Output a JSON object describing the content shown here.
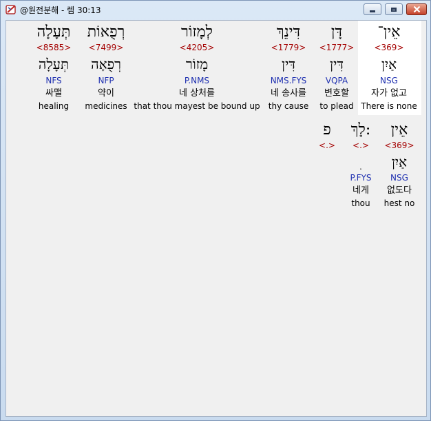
{
  "window": {
    "title": "@원전분해 - 렘 30:13"
  },
  "colors": {
    "strong": "#a40000",
    "morph": "#1e2fb0",
    "highlight": "#ffffff"
  },
  "row1": [
    {
      "heb": "אֵין־",
      "strong": "<369>",
      "heb2": "אַיִן",
      "morph": "NSG",
      "kor": "자가 없고",
      "eng": "There is none",
      "highlight": true
    },
    {
      "heb": "דָּן",
      "strong": "<1777>",
      "heb2": "דִּין",
      "morph": "VQPA",
      "kor": "변호할",
      "eng": "to plead"
    },
    {
      "heb": "דִּינֵךְ",
      "strong": "<1779>",
      "heb2": "דִּין",
      "morph": "NMS.FYS",
      "kor": "네 송사를",
      "eng": "thy cause"
    },
    {
      "heb": "לְמָזוֹר",
      "strong": "<4205>",
      "heb2": "מָזוֹר",
      "morph": "P.NMS",
      "kor": "네 상처를",
      "eng": "that thou mayest be bound up"
    },
    {
      "heb": "רְפֻאוֹת",
      "strong": "<7499>",
      "heb2": "רְפֻאָה",
      "morph": "NFP",
      "kor": "약이",
      "eng": "medicines"
    },
    {
      "heb": "תְּעָלָה",
      "strong": "<8585>",
      "heb2": "תְּעָלָה",
      "morph": "NFS",
      "kor": "싸맬",
      "eng": "healing"
    }
  ],
  "row2": [
    {
      "heb": "אֵין",
      "strong": "<369>",
      "heb2": "אַיִן",
      "morph": "NSG",
      "kor": "없도다",
      "eng": "hest no"
    },
    {
      "heb": "לָךְ:",
      "strong": "<.>",
      "heb2": "ׅ",
      "morph": "P.FYS",
      "kor": "네게",
      "eng": "thou"
    },
    {
      "heb": "פ",
      "strong": "<.>"
    }
  ]
}
